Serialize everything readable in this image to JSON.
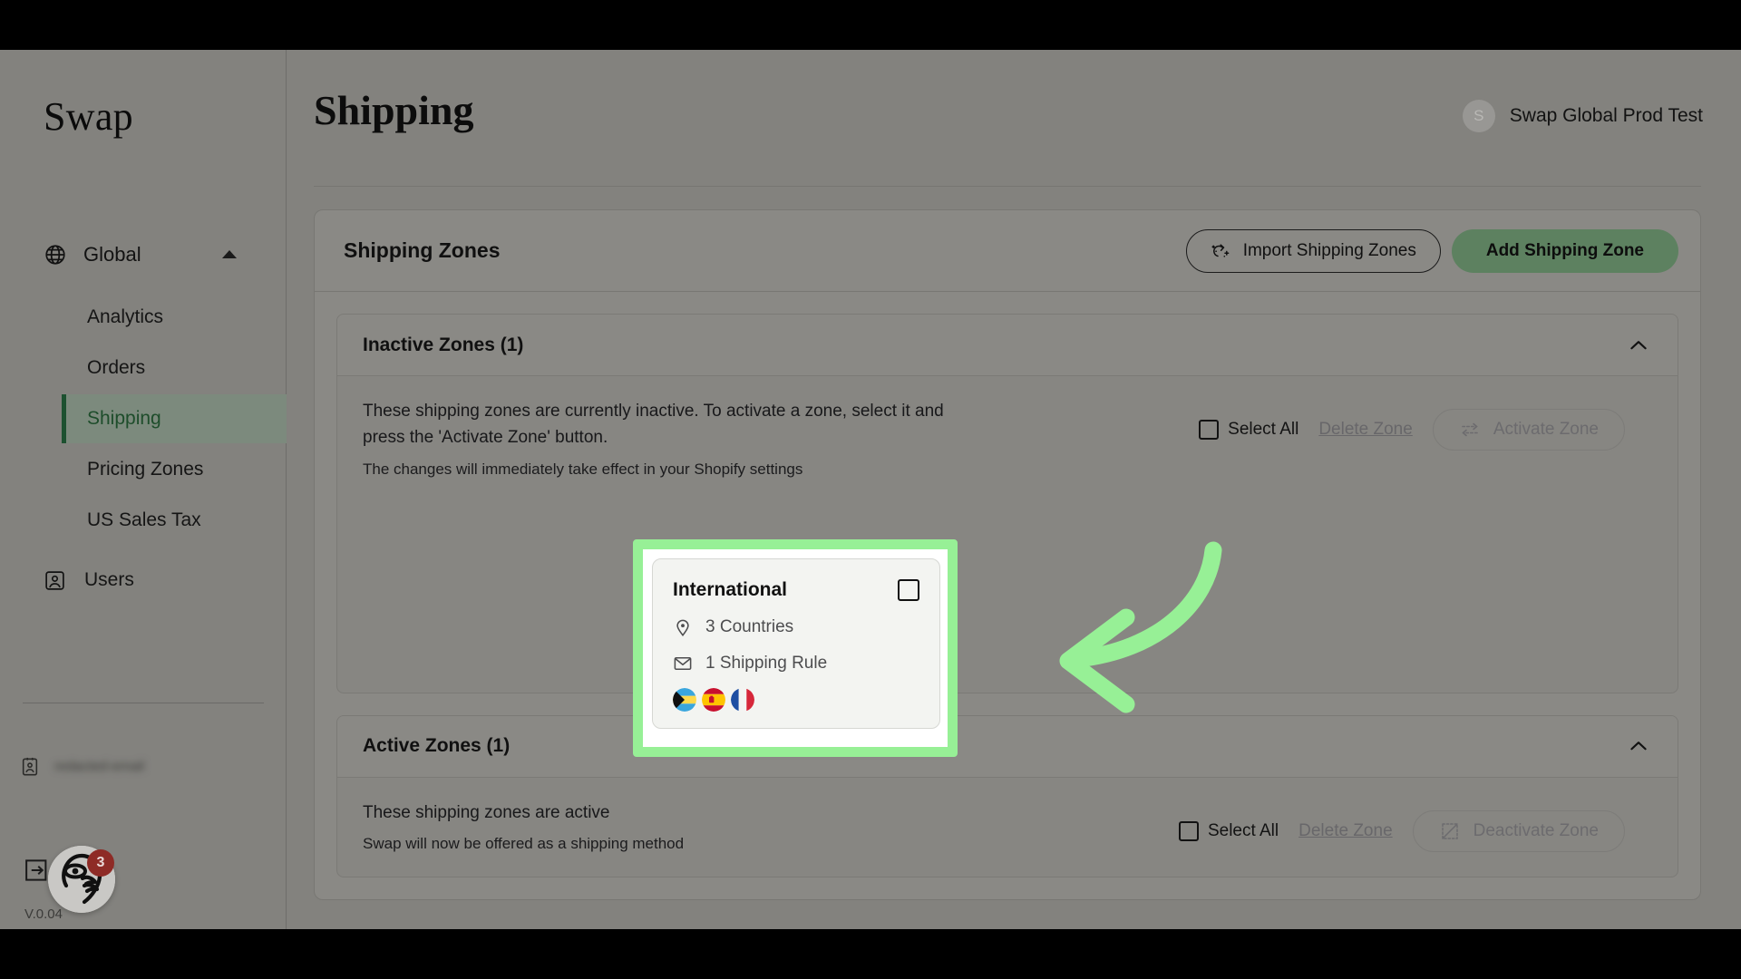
{
  "app": {
    "brand": "Swap",
    "version": "V.0.04",
    "account_email": "redacted-email",
    "cursor_badge_count": "3"
  },
  "sidebar": {
    "group": {
      "label": "Global",
      "icon": "globe-icon",
      "chevron": "chevron-up-icon"
    },
    "items": [
      {
        "label": "Analytics",
        "active": false
      },
      {
        "label": "Orders",
        "active": false
      },
      {
        "label": "Shipping",
        "active": true
      },
      {
        "label": "Pricing Zones",
        "active": false
      },
      {
        "label": "US Sales Tax",
        "active": false
      }
    ],
    "users_item": {
      "label": "Users",
      "icon": "user-card-icon"
    },
    "logout_icon": "logout-icon",
    "account_icon": "contact-card-icon"
  },
  "header": {
    "title": "Shipping",
    "user": {
      "initial": "S",
      "name": "Swap Global Prod Test"
    }
  },
  "panel": {
    "title": "Shipping Zones",
    "import_button": {
      "label": "Import Shipping Zones",
      "icon": "magic-import-icon"
    },
    "add_button": {
      "label": "Add Shipping Zone"
    }
  },
  "inactive_section": {
    "title": "Inactive Zones (1)",
    "collapse_icon": "chevron-up-icon",
    "description_primary": "These shipping zones are currently inactive. To activate a zone, select it and press the 'Activate Zone' button.",
    "description_secondary": "The changes will immediately take effect in your Shopify settings",
    "select_all_label": "Select All",
    "delete_label": "Delete Zone",
    "action_button": {
      "label": "Activate Zone",
      "icon": "transfer-arrows-icon"
    },
    "zones": [
      {
        "name": "International",
        "countries_label": "3 Countries",
        "countries_icon": "map-pin-icon",
        "rules_label": "1 Shipping Rule",
        "rules_icon": "envelope-icon",
        "flags": [
          "Bahamas",
          "Spain",
          "France"
        ]
      }
    ]
  },
  "active_section": {
    "title": "Active Zones (1)",
    "collapse_icon": "chevron-up-icon",
    "description_primary": "These shipping zones are active",
    "description_secondary": "Swap will now be offered as a shipping method",
    "select_all_label": "Select All",
    "delete_label": "Delete Zone",
    "action_button": {
      "label": "Deactivate Zone",
      "icon": "disabled-box-icon"
    }
  },
  "annotation": {
    "arrow_color": "#97f096",
    "highlight_color": "#97f096"
  },
  "colors": {
    "accent_green": "#5d8160",
    "sidebar_bg": "#83827e",
    "active_nav_text": "#1e4d2b",
    "badge_red": "#8e2b26"
  }
}
